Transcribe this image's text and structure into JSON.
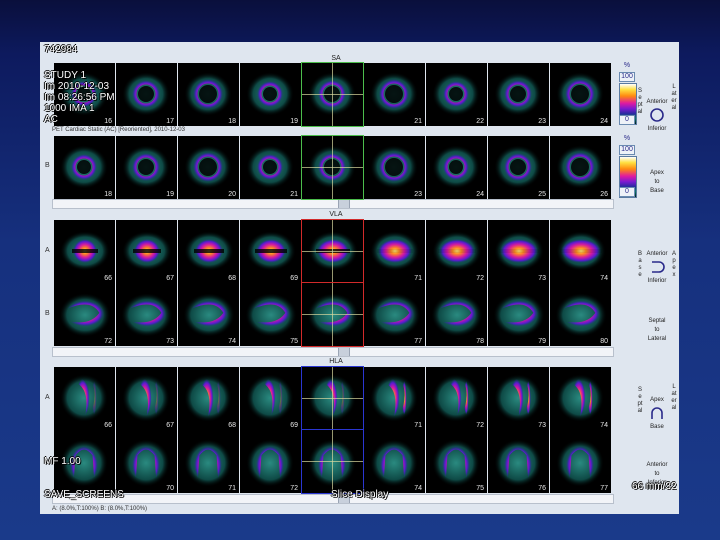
{
  "patient": {
    "id": "742984",
    "study": "STUDY 1",
    "date_line": "Im 2010-12-03",
    "time_line": "Im 08:26:56 PM",
    "ima_line": "1000 IMA 1",
    "ac_line": "AC",
    "mf_line": "MF 1.00"
  },
  "viewer": {
    "footer_left": "SAVE_SCREENS",
    "footer_center": "Slice Display",
    "footer_right": "66 mm/32",
    "status_bar": "A: (8.0%,T:100%)     B: (8.0%,T:100%)"
  },
  "sections": {
    "sa": {
      "label": "SA",
      "series_title": "PET Cardiac Static (AC) [Reoriented], 2010-12-03",
      "row_a": {
        "letter": "",
        "frames": [
          "16",
          "17",
          "18",
          "19",
          "",
          "21",
          "22",
          "23",
          "24"
        ]
      },
      "row_b": {
        "letter": "B",
        "frames": [
          "18",
          "19",
          "20",
          "21",
          "",
          "23",
          "24",
          "25",
          "26"
        ]
      }
    },
    "vla": {
      "label": "VLA",
      "row_a": {
        "letter": "A",
        "frames": [
          "66",
          "67",
          "68",
          "69",
          "",
          "71",
          "72",
          "73",
          "74"
        ]
      },
      "row_b": {
        "letter": "B",
        "frames": [
          "72",
          "73",
          "74",
          "75",
          "",
          "77",
          "78",
          "79",
          "80"
        ]
      }
    },
    "hla": {
      "label": "HLA",
      "row_a": {
        "letter": "A",
        "frames": [
          "66",
          "67",
          "68",
          "69",
          "",
          "71",
          "72",
          "73",
          "74"
        ]
      },
      "row_b": {
        "letter": "",
        "frames": [
          "",
          "70",
          "71",
          "72",
          "",
          "74",
          "75",
          "76",
          "77"
        ]
      }
    }
  },
  "colorbar": {
    "unit": "%",
    "max": "100",
    "min": "0"
  },
  "orientation": {
    "sa": {
      "top": "Anterior",
      "bottom": "Inferior",
      "left_vertical": "Septal",
      "right_vertical": "Lateral",
      "apex_lines": [
        "Apex",
        "to",
        "Base"
      ]
    },
    "vla": {
      "top": "Anterior",
      "bottom": "Inferior",
      "left_vertical": "Base",
      "right_vertical": "Apex",
      "septal_lines": [
        "Septal",
        "to",
        "Lateral"
      ]
    },
    "hla": {
      "top": "Apex",
      "bottom": "Base",
      "left_vertical": "Septal",
      "right_vertical": "Lateral",
      "ant_lines": [
        "Anterior",
        "to",
        "Inferior"
      ]
    }
  },
  "colors": {
    "background": "#16307e",
    "panel": "#dfe6ef",
    "select_sa": "#4cbd4c",
    "select_vla": "#d22a2a",
    "select_hla": "#2a36d2"
  }
}
